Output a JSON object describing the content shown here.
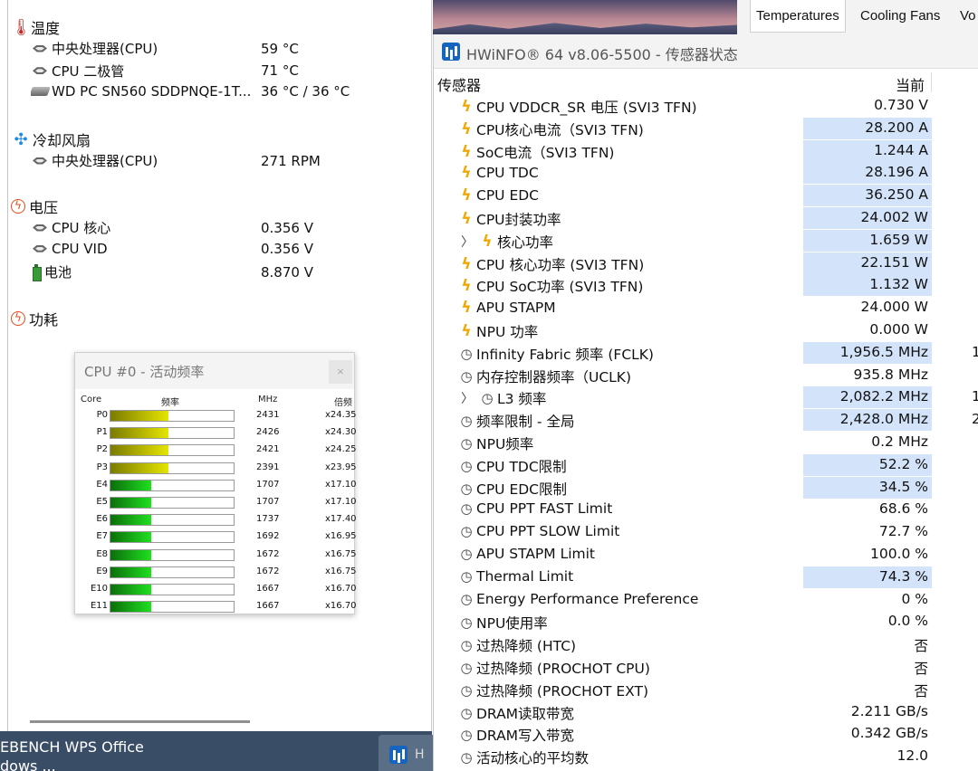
{
  "left_panel": {
    "groups": [
      {
        "icon": "thermometer-icon",
        "label": "温度",
        "items": [
          {
            "icon": "cpu-chip-icon",
            "label": "中央处理器(CPU)",
            "value": "59 °C"
          },
          {
            "icon": "cpu-chip-icon",
            "label": "CPU 二极管",
            "value": "71 °C"
          },
          {
            "icon": "disk-drive-icon",
            "label": "WD PC SN560 SDDPNQE-1T...",
            "value": "36 °C / 36 °C"
          }
        ]
      },
      {
        "icon": "fan-icon",
        "label": "冷却风扇",
        "items": [
          {
            "icon": "cpu-chip-icon",
            "label": "中央处理器(CPU)",
            "value": "271 RPM"
          }
        ]
      },
      {
        "icon": "voltage-icon",
        "label": "电压",
        "items": [
          {
            "icon": "cpu-chip-icon",
            "label": "CPU 核心",
            "value": "0.356 V"
          },
          {
            "icon": "cpu-chip-icon",
            "label": "CPU VID",
            "value": "0.356 V"
          },
          {
            "icon": "battery-icon",
            "label": "电池",
            "value": "8.870 V"
          }
        ]
      },
      {
        "icon": "power-icon",
        "label": "功耗",
        "items": []
      }
    ]
  },
  "freq_gadget": {
    "title": "CPU #0 - 活动频率",
    "close": "×",
    "headers": {
      "core": "Core",
      "freq": "频率",
      "mhz": "MHz",
      "mult": "倍频"
    },
    "rows": [
      {
        "core": "P0",
        "mhz": "2431",
        "mult": "x24.35",
        "level": 0.47,
        "type": "p"
      },
      {
        "core": "P1",
        "mhz": "2426",
        "mult": "x24.30",
        "level": 0.47,
        "type": "p"
      },
      {
        "core": "P2",
        "mhz": "2421",
        "mult": "x24.25",
        "level": 0.47,
        "type": "p"
      },
      {
        "core": "P3",
        "mhz": "2391",
        "mult": "x23.95",
        "level": 0.47,
        "type": "p"
      },
      {
        "core": "E4",
        "mhz": "1707",
        "mult": "x17.10",
        "level": 0.33,
        "type": "e"
      },
      {
        "core": "E5",
        "mhz": "1707",
        "mult": "x17.10",
        "level": 0.33,
        "type": "e"
      },
      {
        "core": "E6",
        "mhz": "1737",
        "mult": "x17.40",
        "level": 0.33,
        "type": "e"
      },
      {
        "core": "E7",
        "mhz": "1692",
        "mult": "x16.95",
        "level": 0.33,
        "type": "e"
      },
      {
        "core": "E8",
        "mhz": "1672",
        "mult": "x16.75",
        "level": 0.33,
        "type": "e"
      },
      {
        "core": "E9",
        "mhz": "1672",
        "mult": "x16.75",
        "level": 0.33,
        "type": "e"
      },
      {
        "core": "E10",
        "mhz": "1667",
        "mult": "x16.70",
        "level": 0.33,
        "type": "e"
      },
      {
        "core": "E11",
        "mhz": "1667",
        "mult": "x16.70",
        "level": 0.33,
        "type": "e"
      }
    ]
  },
  "tabs": [
    {
      "label": "Temperatures",
      "active": true
    },
    {
      "label": "Cooling Fans",
      "active": false
    },
    {
      "label": "Vo",
      "active": false
    }
  ],
  "hwinfo": {
    "title": "HWiNFO® 64 v8.06-5500 - 传感器状态",
    "col_sensor": "传感器",
    "col_current": "当前",
    "rows": [
      {
        "icon": "bolt",
        "name": "CPU VDDCR_SR 电压 (SVI3 TFN)",
        "value": "0.730 V",
        "hl": false,
        "extra": ""
      },
      {
        "icon": "bolt",
        "name": "CPU核心电流（SVI3 TFN)",
        "value": "28.200 A",
        "hl": true,
        "extra": ""
      },
      {
        "icon": "bolt",
        "name": "SoC电流（SVI3 TFN)",
        "value": "1.244 A",
        "hl": true,
        "extra": ""
      },
      {
        "icon": "bolt",
        "name": "CPU TDC",
        "value": "28.196 A",
        "hl": true,
        "extra": ""
      },
      {
        "icon": "bolt",
        "name": "CPU EDC",
        "value": "36.250 A",
        "hl": true,
        "extra": ""
      },
      {
        "icon": "bolt",
        "name": "CPU封装功率",
        "value": "24.002 W",
        "hl": true,
        "extra": ""
      },
      {
        "icon": "bolt",
        "name": "核心功率",
        "value": "1.659 W",
        "hl": true,
        "extra": "",
        "expand": true
      },
      {
        "icon": "bolt",
        "name": "CPU 核心功率 (SVI3 TFN)",
        "value": "22.151 W",
        "hl": true,
        "extra": ""
      },
      {
        "icon": "bolt",
        "name": "CPU SoC功率 (SVI3 TFN)",
        "value": "1.132 W",
        "hl": true,
        "extra": ""
      },
      {
        "icon": "bolt",
        "name": "APU STAPM",
        "value": "24.000 W",
        "hl": false,
        "extra": ""
      },
      {
        "icon": "bolt",
        "name": "NPU 功率",
        "value": "0.000 W",
        "hl": false,
        "extra": ""
      },
      {
        "icon": "clock",
        "name": "Infinity Fabric 频率 (FCLK)",
        "value": "1,956.5 MHz",
        "hl": true,
        "extra": "1"
      },
      {
        "icon": "clock",
        "name": "内存控制器频率（UCLK)",
        "value": "935.8 MHz",
        "hl": false,
        "extra": ""
      },
      {
        "icon": "clock",
        "name": "L3 频率",
        "value": "2,082.2 MHz",
        "hl": true,
        "extra": "1",
        "expand": true
      },
      {
        "icon": "clock",
        "name": "频率限制 - 全局",
        "value": "2,428.0 MHz",
        "hl": true,
        "extra": "2"
      },
      {
        "icon": "clock",
        "name": "NPU频率",
        "value": "0.2 MHz",
        "hl": false,
        "extra": ""
      },
      {
        "icon": "clock",
        "name": "CPU TDC限制",
        "value": "52.2 %",
        "hl": true,
        "extra": ""
      },
      {
        "icon": "clock",
        "name": "CPU EDC限制",
        "value": "34.5 %",
        "hl": true,
        "extra": ""
      },
      {
        "icon": "clock",
        "name": "CPU PPT FAST Limit",
        "value": "68.6 %",
        "hl": false,
        "extra": ""
      },
      {
        "icon": "clock",
        "name": "CPU PPT SLOW Limit",
        "value": "72.7 %",
        "hl": false,
        "extra": ""
      },
      {
        "icon": "clock",
        "name": "APU STAPM Limit",
        "value": "100.0 %",
        "hl": false,
        "extra": ""
      },
      {
        "icon": "clock",
        "name": "Thermal Limit",
        "value": "74.3 %",
        "hl": true,
        "extra": ""
      },
      {
        "icon": "clock",
        "name": "Energy Performance Preference",
        "value": "0 %",
        "hl": false,
        "extra": ""
      },
      {
        "icon": "clock",
        "name": "NPU使用率",
        "value": "0.0 %",
        "hl": false,
        "extra": ""
      },
      {
        "icon": "clock",
        "name": "过热降频 (HTC)",
        "value": "否",
        "hl": false,
        "extra": ""
      },
      {
        "icon": "clock",
        "name": "过热降频 (PROCHOT CPU)",
        "value": "否",
        "hl": false,
        "extra": ""
      },
      {
        "icon": "clock",
        "name": "过热降频 (PROCHOT EXT)",
        "value": "否",
        "hl": false,
        "extra": ""
      },
      {
        "icon": "clock",
        "name": "DRAM读取带宽",
        "value": "2.211 GB/s",
        "hl": false,
        "extra": ""
      },
      {
        "icon": "clock",
        "name": "DRAM写入带宽",
        "value": "0.342 GB/s",
        "hl": false,
        "extra": ""
      },
      {
        "icon": "clock",
        "name": "活动核心的平均数",
        "value": "12.0",
        "hl": false,
        "extra": ""
      }
    ]
  },
  "taskbar": {
    "line1": "EBENCH   WPS Office",
    "line2": "dows ...",
    "app_fragment": "H"
  },
  "colors": {
    "highlight": "#d3e3fa",
    "bolt": "#f0a800",
    "p_core_bar": "#e5e500",
    "e_core_bar": "#1fe01f"
  }
}
